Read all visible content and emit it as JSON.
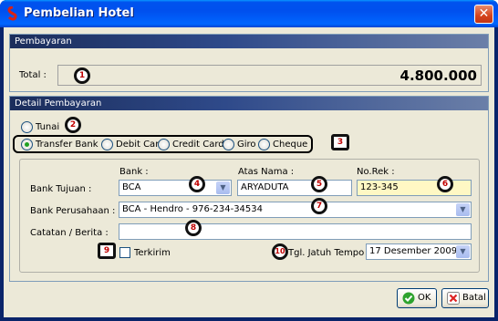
{
  "window": {
    "title": "Pembelian Hotel",
    "close_label": "✕"
  },
  "payment": {
    "header": "Pembayaran",
    "total_label": "Total :",
    "total_value": "4.800.000"
  },
  "detail": {
    "header": "Detail Pembayaran",
    "payment_methods": [
      "Tunai",
      "Transfer Bank",
      "Debit Card",
      "Credit Card",
      "Giro",
      "Cheque"
    ],
    "selected_method": "Transfer Bank",
    "bank_tujuan_label": "Bank Tujuan :",
    "bank_col_label": "Bank :",
    "atas_nama_col_label": "Atas Nama :",
    "norek_col_label": "No.Rek :",
    "bank_value": "BCA",
    "atas_nama_value": "ARYADUTA",
    "norek_value": "123-345",
    "bank_perusahaan_label": "Bank Perusahaan :",
    "bank_perusahaan_value": "BCA - Hendro - 976-234-34534",
    "catatan_label": "Catatan / Berita :",
    "catatan_value": "",
    "terkirim_label": "Terkirim",
    "terkirim_checked": false,
    "jatuh_tempo_label": "Tgl. Jatuh Tempo :",
    "jatuh_tempo_value": "17 Desember 2009"
  },
  "markers": [
    "1",
    "2",
    "3",
    "4",
    "5",
    "6",
    "7",
    "8",
    "9",
    "10"
  ],
  "buttons": {
    "ok_label": "OK",
    "cancel_label": "Batal"
  },
  "colors": {
    "titlebar": "#0053ee",
    "panel_header": "#1b2d5b",
    "highlight_field": "#fff8c4",
    "marker_text": "#c00000"
  }
}
